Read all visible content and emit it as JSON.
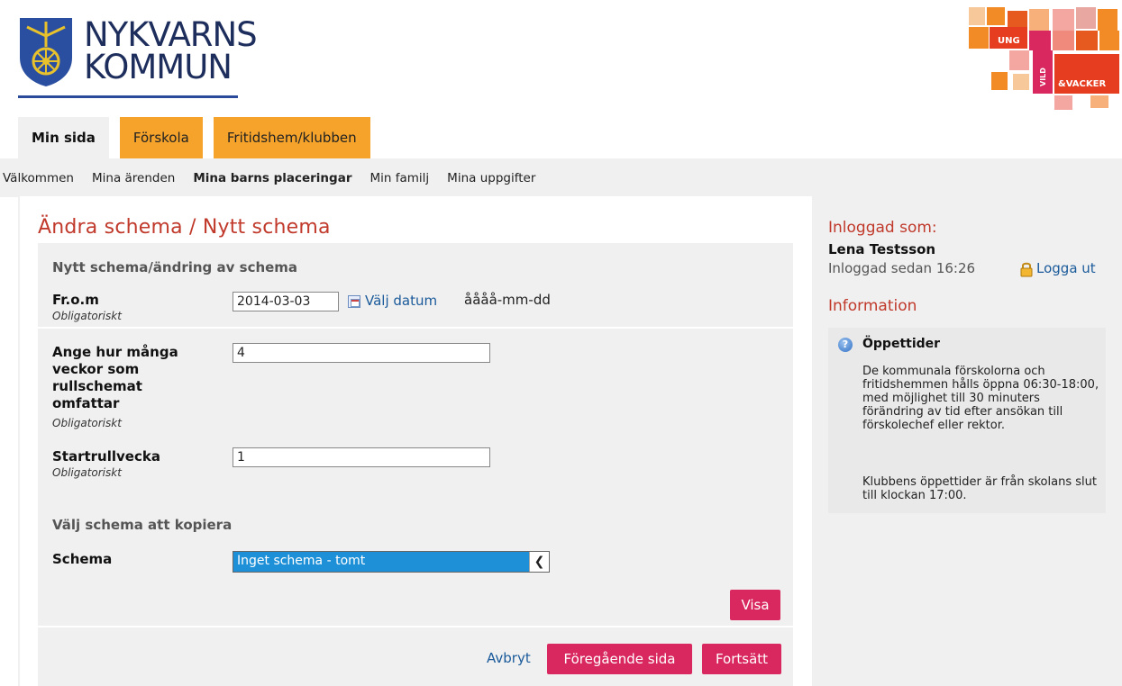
{
  "header": {
    "logo_line1": "NYKVARNS",
    "logo_line2": "KOMMUN"
  },
  "tabs": [
    {
      "label": "Min sida",
      "active": true
    },
    {
      "label": "Förskola",
      "active": false
    },
    {
      "label": "Fritidshem/klubben",
      "active": false
    }
  ],
  "subnav": [
    {
      "label": "Välkommen"
    },
    {
      "label": "Mina ärenden"
    },
    {
      "label": "Mina barns placeringar",
      "bold": true
    },
    {
      "label": "Min familj"
    },
    {
      "label": "Mina uppgifter"
    }
  ],
  "page": {
    "title": "Ändra schema / Nytt schema",
    "section1_title": "Nytt schema/ändring av schema",
    "from_label": "Fr.o.m",
    "required": "Obligatoriskt",
    "from_value": "2014-03-03",
    "pick_date": "Välj datum",
    "date_hint": "åååå-mm-dd",
    "weeks_label_lines": [
      "Ange hur många",
      "veckor som",
      "rullschemat",
      "omfattar"
    ],
    "weeks_value": "4",
    "start_week_label": "Startrullvecka",
    "start_week_value": "1",
    "section2_title": "Välj schema att kopiera",
    "schedule_label": "Schema",
    "schedule_selected": "Inget schema - tomt",
    "show_button": "Visa",
    "cancel_link": "Avbryt",
    "prev_button": "Föregående sida",
    "continue_button": "Fortsätt"
  },
  "sidebar": {
    "logged_in_title": "Inloggad som:",
    "user_name": "Lena Testsson",
    "logged_in_since": "Inloggad sedan 16:26",
    "logout": "Logga ut",
    "info_title": "Information",
    "info_heading": "Öppettider",
    "info_text1": "De kommunala förskolorna och fritidshemmen hålls öppna 06:30-18:00, med möjlighet till 30 minuters förändring av tid efter ansökan till förskolechef eller rektor.",
    "info_text2": "Klubbens öppettider är från skolans slut till klockan 17:00."
  },
  "brand": {
    "ung": "UNG",
    "vild": "VILD",
    "vacker": "&VACKER"
  },
  "colors": {
    "accent_red": "#c0392b",
    "button_pink": "#d9275f",
    "tab_orange": "#f5a32a",
    "link_blue": "#1a5a9a",
    "select_blue": "#1e90d8"
  }
}
